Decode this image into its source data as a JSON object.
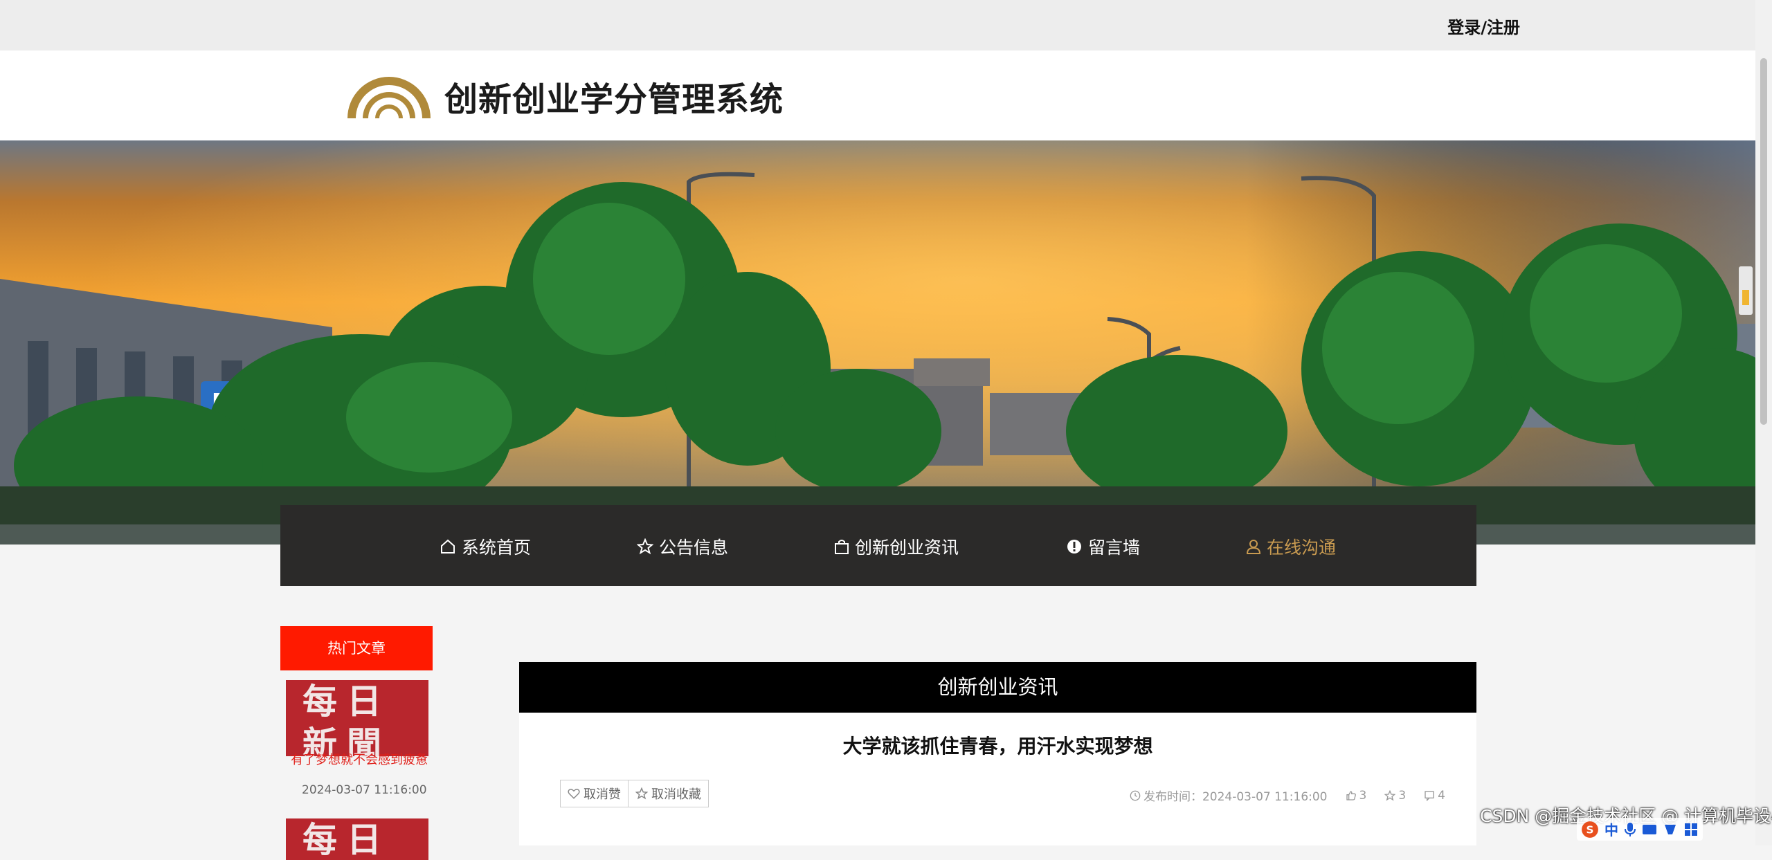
{
  "top_bar": {
    "login_label": "登录/注册"
  },
  "header": {
    "site_title": "创新创业学分管理系统"
  },
  "nav": {
    "items": [
      {
        "label": "系统首页",
        "icon": "home-icon"
      },
      {
        "label": "公告信息",
        "icon": "star-icon"
      },
      {
        "label": "创新创业资讯",
        "icon": "bag-icon"
      },
      {
        "label": "留言墙",
        "icon": "alert-circle-icon"
      },
      {
        "label": "在线沟通",
        "icon": "user-icon",
        "active": true
      }
    ],
    "active_color": "#c89a50"
  },
  "sidebar": {
    "title": "热门文章",
    "title_bg": "#ff1a00",
    "items": [
      {
        "thumb_text": "每日新聞",
        "caption": "有了梦想就不会感到疲惫",
        "date": "2024-03-07 11:16:00"
      },
      {
        "thumb_text": "每日"
      }
    ]
  },
  "article": {
    "section_title": "创新创业资讯",
    "title": "大学就该抓住青春，用汗水实现梦想",
    "unlike_label": "取消赞",
    "uncollect_label": "取消收藏",
    "publish_label": "发布时间：2024-03-07 11:16:00",
    "likes": "3",
    "collects": "3",
    "comments": "4"
  },
  "watermark": {
    "text": "CSDN @掘金技术社区 @ 计算机毕设小月哥"
  },
  "ime": {
    "label": "中"
  }
}
